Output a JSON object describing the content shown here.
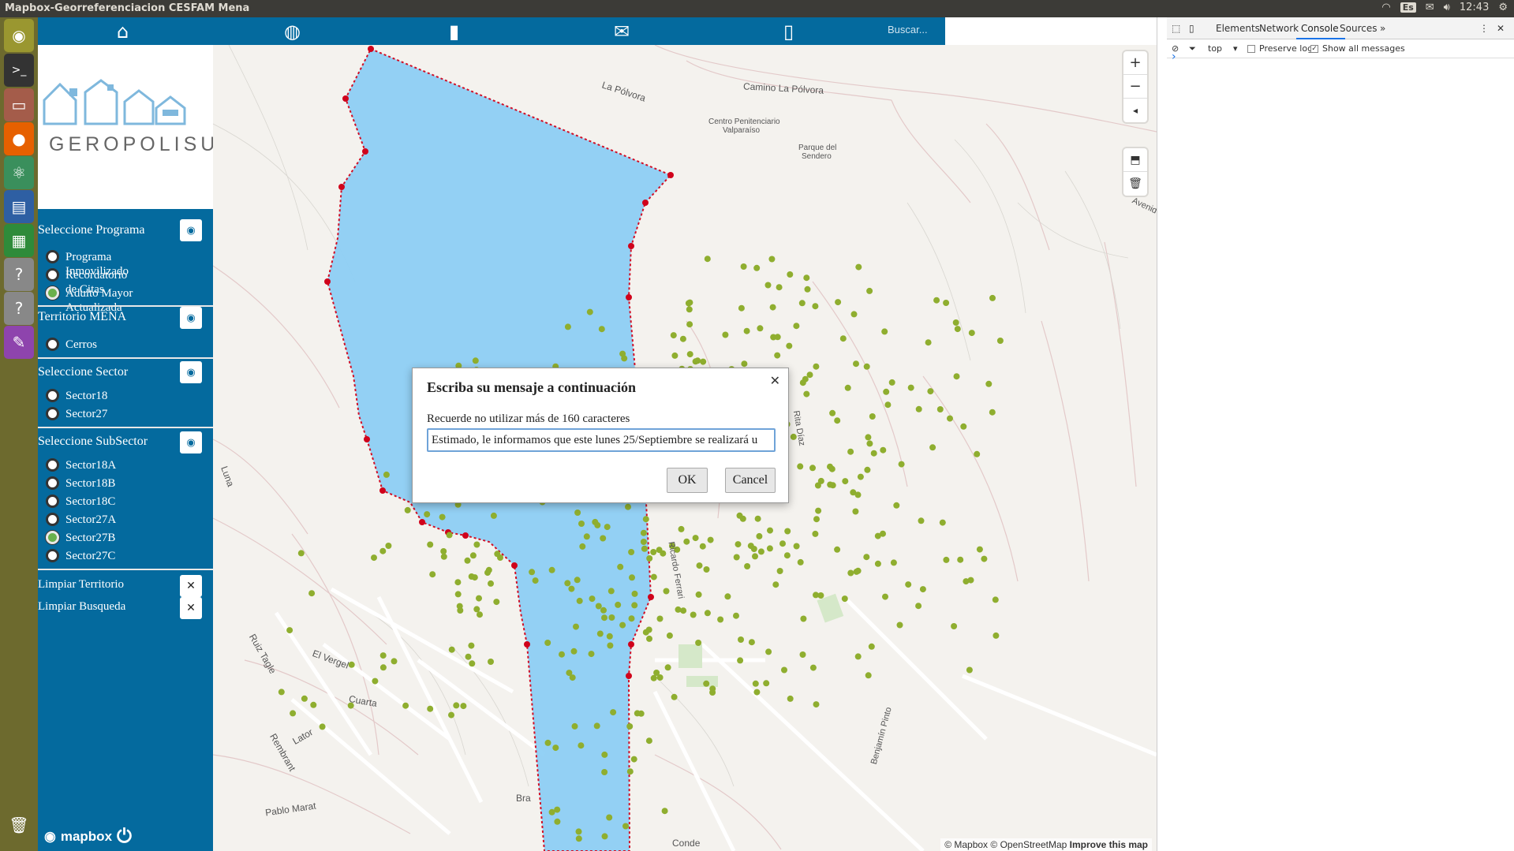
{
  "os": {
    "window_title": "Mapbox-Georreferenciacion CESFAM Mena",
    "keyboard": "Es",
    "time": "12:43"
  },
  "nav": {
    "icons": [
      "home-icon",
      "globe-icon",
      "contacts-icon",
      "mail-icon",
      "id-badge-icon"
    ],
    "search_placeholder": "Buscar..."
  },
  "logo": {
    "text": "GEROPOLISUV"
  },
  "sidebar": {
    "programa": {
      "title": "Seleccione Programa",
      "options": [
        {
          "label": "Programa Inmovilizado",
          "selected": false
        },
        {
          "label": "Recordatorio de Citas",
          "selected": false
        },
        {
          "label": "Adulto Mayor Actualizada",
          "selected": true
        }
      ]
    },
    "territorio": {
      "title": "Territorio MENA",
      "options": [
        {
          "label": "Cerros",
          "selected": false
        }
      ]
    },
    "sector": {
      "title": "Seleccione Sector",
      "options": [
        {
          "label": "Sector18",
          "selected": false
        },
        {
          "label": "Sector27",
          "selected": false
        }
      ]
    },
    "subsector": {
      "title": "Seleccione SubSector",
      "options": [
        {
          "label": "Sector18A",
          "selected": false
        },
        {
          "label": "Sector18B",
          "selected": false
        },
        {
          "label": "Sector18C",
          "selected": false
        },
        {
          "label": "Sector27A",
          "selected": false
        },
        {
          "label": "Sector27B",
          "selected": true
        },
        {
          "label": "Sector27C",
          "selected": false
        }
      ]
    },
    "limpiar_territorio": "Limpiar Territorio",
    "limpiar_busqueda": "Limpiar Busqueda",
    "mapbox_label": "mapbox"
  },
  "map": {
    "labels": {
      "la_polvora": "La Pólvora",
      "camino_la_polvora": "Camino La Pólvora",
      "centro_penitenciario": "Centro Penitenciario",
      "valparaiso": "Valparaíso",
      "parque_del": "Parque del",
      "sendero": "Sendero",
      "avenida": "Avenid",
      "el_vergel": "El Vergel",
      "cuarta": "Cuarta",
      "ruiz_tagle": "Ruiz Tagle",
      "rembrant": "Rembrant",
      "lator": "Lator",
      "pablo_marat": "Pablo Marat",
      "ricardo_ferrari": "Ricardo Ferrari",
      "rita_diaz": "Rita Díaz",
      "beneficiario_pinto": "Benjamín Pinto",
      "bra": "Bra",
      "conde": "Conde",
      "luna": "Luna"
    },
    "attribution": [
      "© Mapbox",
      "© OpenStreetMap",
      "Improve this map"
    ],
    "colors": {
      "polygon_fill": "#8ecff5",
      "polygon_stroke": "#d0021b",
      "point": "#8fae2f"
    }
  },
  "modal": {
    "title": "Escriba su mensaje a continuación",
    "hint": "Recuerde no utilizar más de 160 caracteres",
    "value": "Estimado, le informamos que este lunes 25/Septiembre se realizará u",
    "ok": "OK",
    "cancel": "Cancel"
  },
  "devtools": {
    "tabs": [
      "Elements",
      "Network",
      "Console",
      "Sources"
    ],
    "active_tab": "Console",
    "context": "top",
    "preserve_log": "Preserve log",
    "show_all": "Show all messages",
    "prompt": "›"
  }
}
